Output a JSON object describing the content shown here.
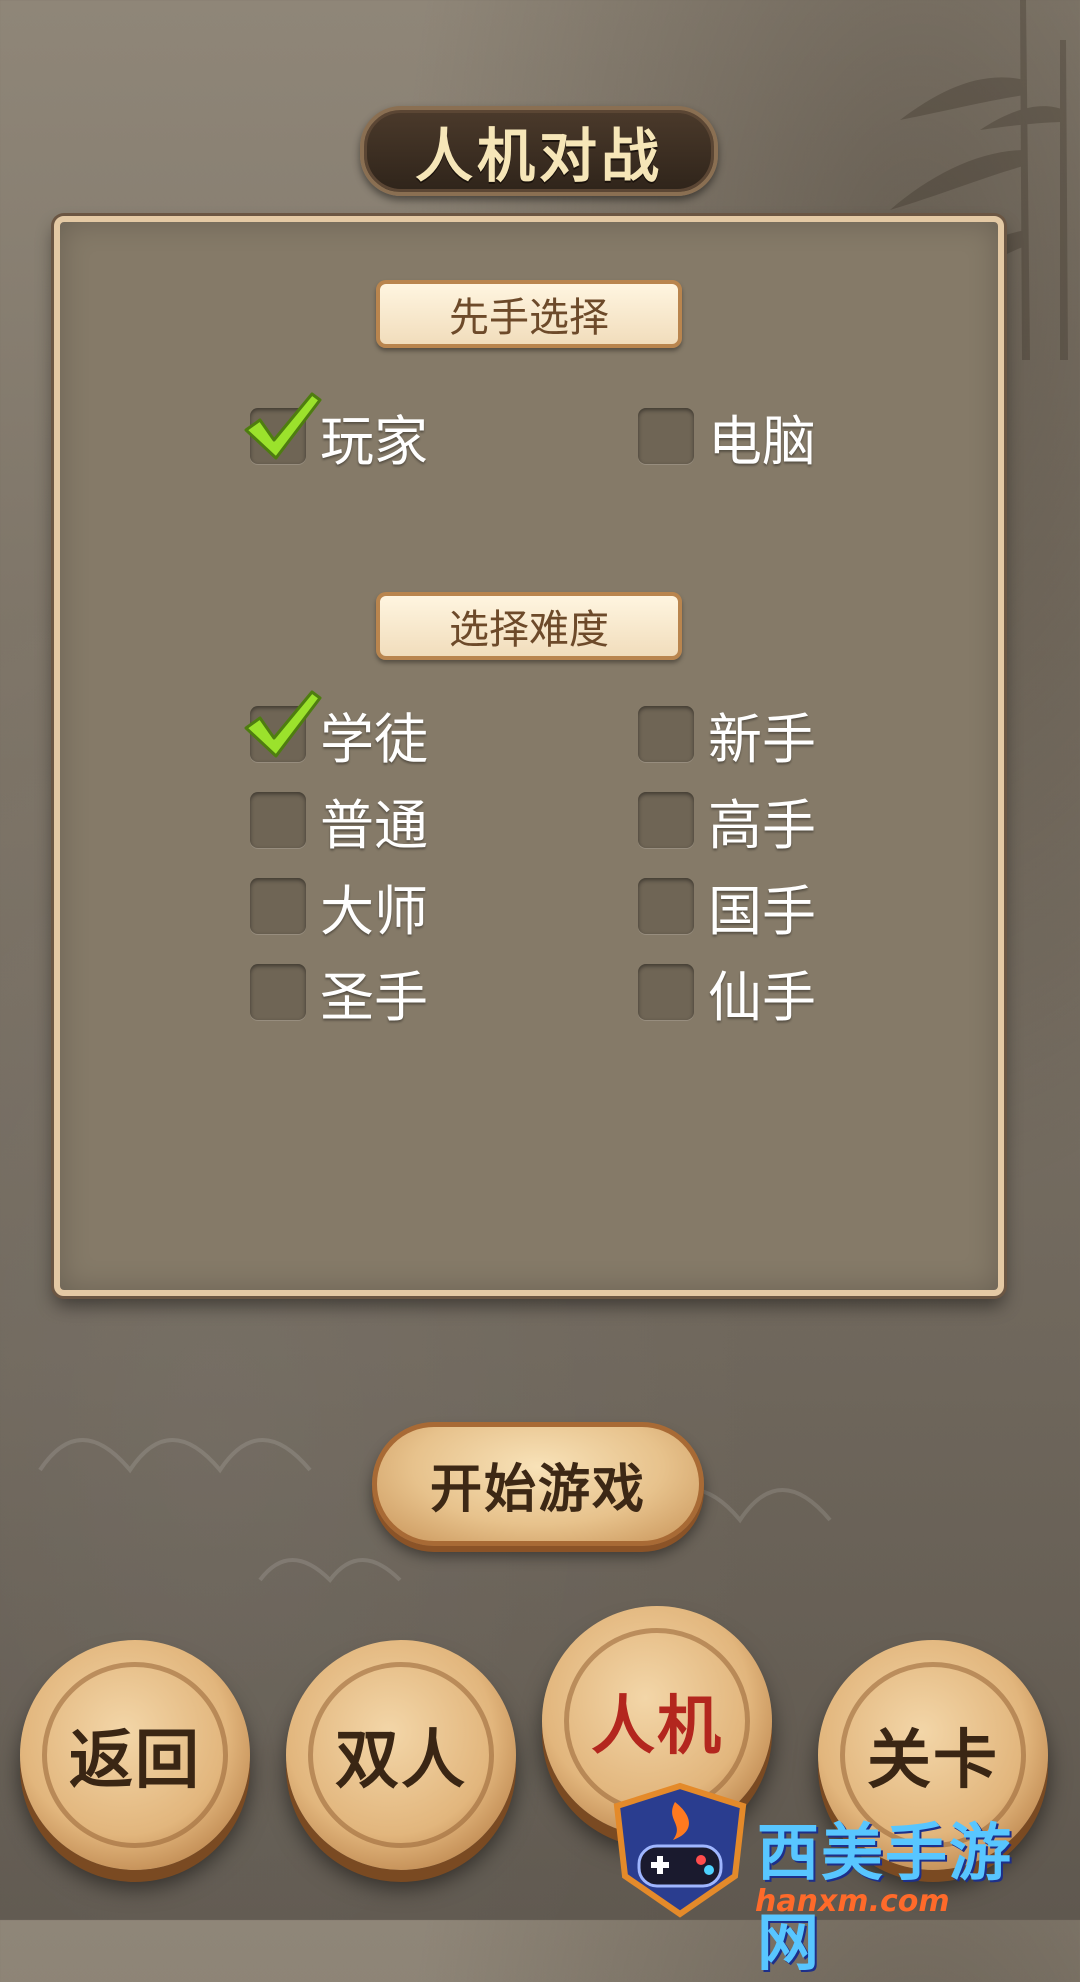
{
  "header": {
    "title": "人机对战"
  },
  "first_move": {
    "label": "先手选择",
    "options": [
      {
        "label": "玩家",
        "checked": true
      },
      {
        "label": "电脑",
        "checked": false
      }
    ]
  },
  "difficulty": {
    "label": "选择难度",
    "options": [
      {
        "label": "学徒",
        "checked": true
      },
      {
        "label": "新手",
        "checked": false
      },
      {
        "label": "普通",
        "checked": false
      },
      {
        "label": "高手",
        "checked": false
      },
      {
        "label": "大师",
        "checked": false
      },
      {
        "label": "国手",
        "checked": false
      },
      {
        "label": "圣手",
        "checked": false
      },
      {
        "label": "仙手",
        "checked": false
      }
    ]
  },
  "start_button": {
    "label": "开始游戏"
  },
  "bottom_nav": {
    "items": [
      {
        "label": "返回",
        "active": false
      },
      {
        "label": "双人",
        "active": false
      },
      {
        "label": "人机",
        "active": true
      },
      {
        "label": "关卡",
        "active": false
      }
    ]
  },
  "watermark": {
    "brand": "西美手游网",
    "domain": "hanxm.com"
  },
  "colors": {
    "panel": "#857a68",
    "check": "#9be22c",
    "active_piece_text": "#b3261e"
  }
}
